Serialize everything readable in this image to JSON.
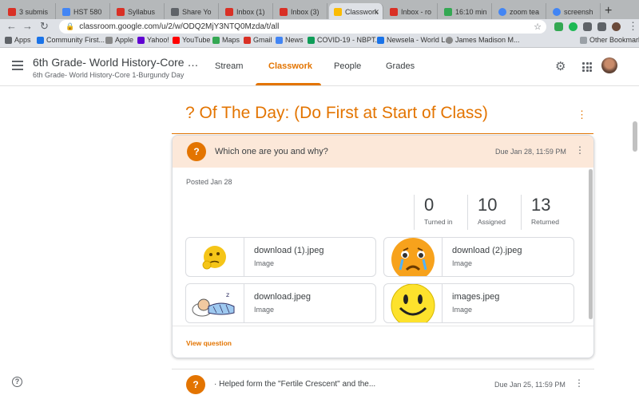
{
  "browser": {
    "tabs": [
      {
        "label": "3 submis",
        "color": "#d93025"
      },
      {
        "label": "HST 580",
        "color": "#4285f4"
      },
      {
        "label": "Syllabus",
        "color": "#d93025"
      },
      {
        "label": "Share Yo",
        "color": "#5f6368"
      },
      {
        "label": "Inbox (1)",
        "color": "#d93025"
      },
      {
        "label": "Inbox (3)",
        "color": "#d93025"
      },
      {
        "label": "Classwork",
        "color": "#fbbc04"
      },
      {
        "label": "Inbox - ro",
        "color": "#d93025"
      },
      {
        "label": "16:10 min",
        "color": "#34a853"
      },
      {
        "label": "zoom tea",
        "color": "#4285f4"
      },
      {
        "label": "screensh",
        "color": "#4285f4"
      }
    ],
    "url": "classroom.google.com/u/2/w/ODQ2MjY3NTQ0Mzda/t/all",
    "bookmarks": [
      "Apps",
      "Community First...",
      "Apple",
      "Yahoo!",
      "YouTube",
      "Maps",
      "Gmail",
      "News",
      "COVID-19 - NBPT...",
      "Newsela - World L...",
      "James Madison M..."
    ],
    "other_bookmarks": "Other Bookmarks"
  },
  "header": {
    "course_title": "6th Grade- World History-Core 1-Burgundy Day",
    "course_subtitle": "6th Grade- World History-Core 1-Burgundy Day",
    "tabs": [
      "Stream",
      "Classwork",
      "People",
      "Grades"
    ],
    "active_tab": "Classwork"
  },
  "topic": {
    "title": "? Of The Day: (Do First at Start of Class)"
  },
  "assignment": {
    "title": "Which one are you and why?",
    "due": "Due Jan 28, 11:59 PM",
    "posted": "Posted Jan 28",
    "stats": [
      {
        "num": "0",
        "label": "Turned in"
      },
      {
        "num": "10",
        "label": "Assigned"
      },
      {
        "num": "13",
        "label": "Returned"
      }
    ],
    "attachments": [
      {
        "name": "download (1).jpeg",
        "type": "Image",
        "thumb": "thinking-emoji"
      },
      {
        "name": "download (2).jpeg",
        "type": "Image",
        "thumb": "crying-emoji"
      },
      {
        "name": "download.jpeg",
        "type": "Image",
        "thumb": "sleeping-cartoon"
      },
      {
        "name": "images.jpeg",
        "type": "Image",
        "thumb": "smiley-emoji"
      }
    ],
    "view_link": "View question"
  },
  "next_assignment": {
    "title": "· Helped form the \"Fertile Crescent\" and the...",
    "due": "Due Jan 25, 11:59 PM"
  },
  "colors": {
    "accent": "#e37400",
    "card_header_bg": "#fce8d9"
  }
}
